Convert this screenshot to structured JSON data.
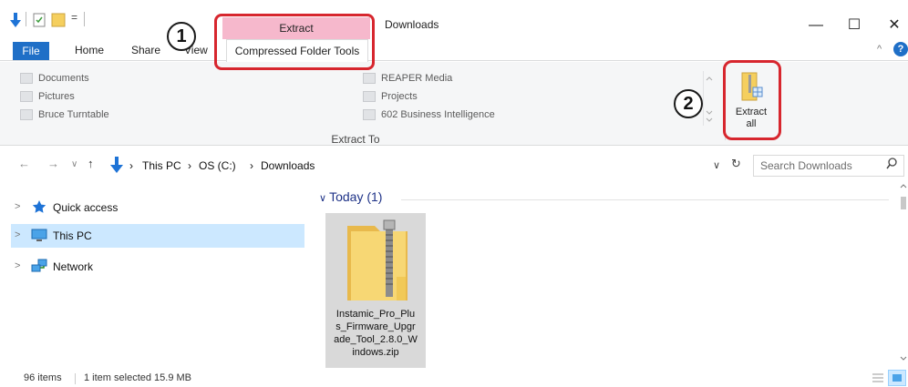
{
  "window": {
    "title": "Downloads",
    "context_tab_header": "Extract",
    "controls": {
      "minimize": "—",
      "maximize": "☐",
      "close": "✕"
    }
  },
  "ribbon": {
    "tabs": {
      "file": "File",
      "home": "Home",
      "share": "Share",
      "view": "View",
      "compressed": "Compressed Folder Tools"
    },
    "collapse_glyph": "^",
    "help_glyph": "?",
    "destinations_left": [
      "Documents",
      "Pictures",
      "Bruce Turntable"
    ],
    "destinations_right": [
      "REAPER Media",
      "Projects",
      "602 Business Intelligence"
    ],
    "group_label": "Extract To",
    "extract_all": {
      "line1": "Extract",
      "line2": "all"
    }
  },
  "address": {
    "breadcrumbs": [
      "This PC",
      "OS (C:)",
      "Downloads"
    ],
    "search_placeholder": "Search Downloads"
  },
  "nav_pane": {
    "items": [
      {
        "label": "Quick access",
        "icon": "star-icon"
      },
      {
        "label": "This PC",
        "icon": "computer-icon",
        "selected": true
      },
      {
        "label": "Network",
        "icon": "network-icon"
      }
    ]
  },
  "content": {
    "group_header": "Today (1)",
    "file": {
      "name": "Instamic_Pro_Plus_Firmware_Upgrade_Tool_2.8.0_Windows.zip",
      "name_lines": [
        "Instamic_Pro_Plu",
        "s_Firmware_Upgr",
        "ade_Tool_2.8.0_W",
        "indows.zip"
      ],
      "icon": "zip-folder-icon"
    }
  },
  "status": {
    "item_count": "96 items",
    "selection": "1 item selected  15.9 MB"
  },
  "annotations": {
    "step1": "1",
    "step2": "2",
    "color": "#d7262e"
  },
  "colors": {
    "file_tab": "#1f6fc7",
    "context_tab": "#f6b8cc",
    "selection": "#cce8ff",
    "folder_yellow": "#f7d774"
  }
}
